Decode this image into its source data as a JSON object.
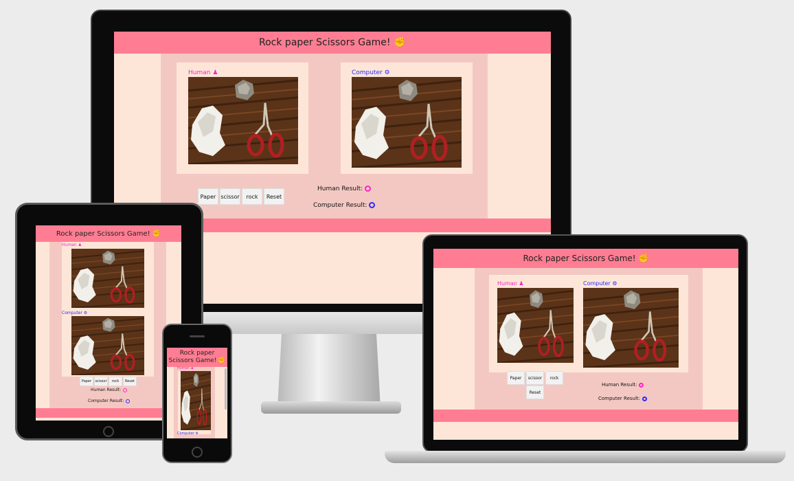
{
  "site": {
    "title": "Rock paper Scissors Game!",
    "title_line1": "Rock paper",
    "title_line2": "Scissors Game!",
    "title_icon": "hand-fist-icon",
    "human_label": "Human",
    "human_icon": "user-icon",
    "computer_label": "Computer",
    "computer_icon": "robot-icon",
    "buttons": {
      "paper": "Paper",
      "scissor": "scissor",
      "rock": "rock",
      "reset": "Reset"
    },
    "human_result_label": "Human Result:",
    "computer_result_label": "Computer Result:",
    "colors": {
      "header": "#ff7d92",
      "background": "#fde6d8",
      "game_panel": "#f4c8c2",
      "human": "#ff20c8",
      "computer": "#2a2aff"
    }
  }
}
